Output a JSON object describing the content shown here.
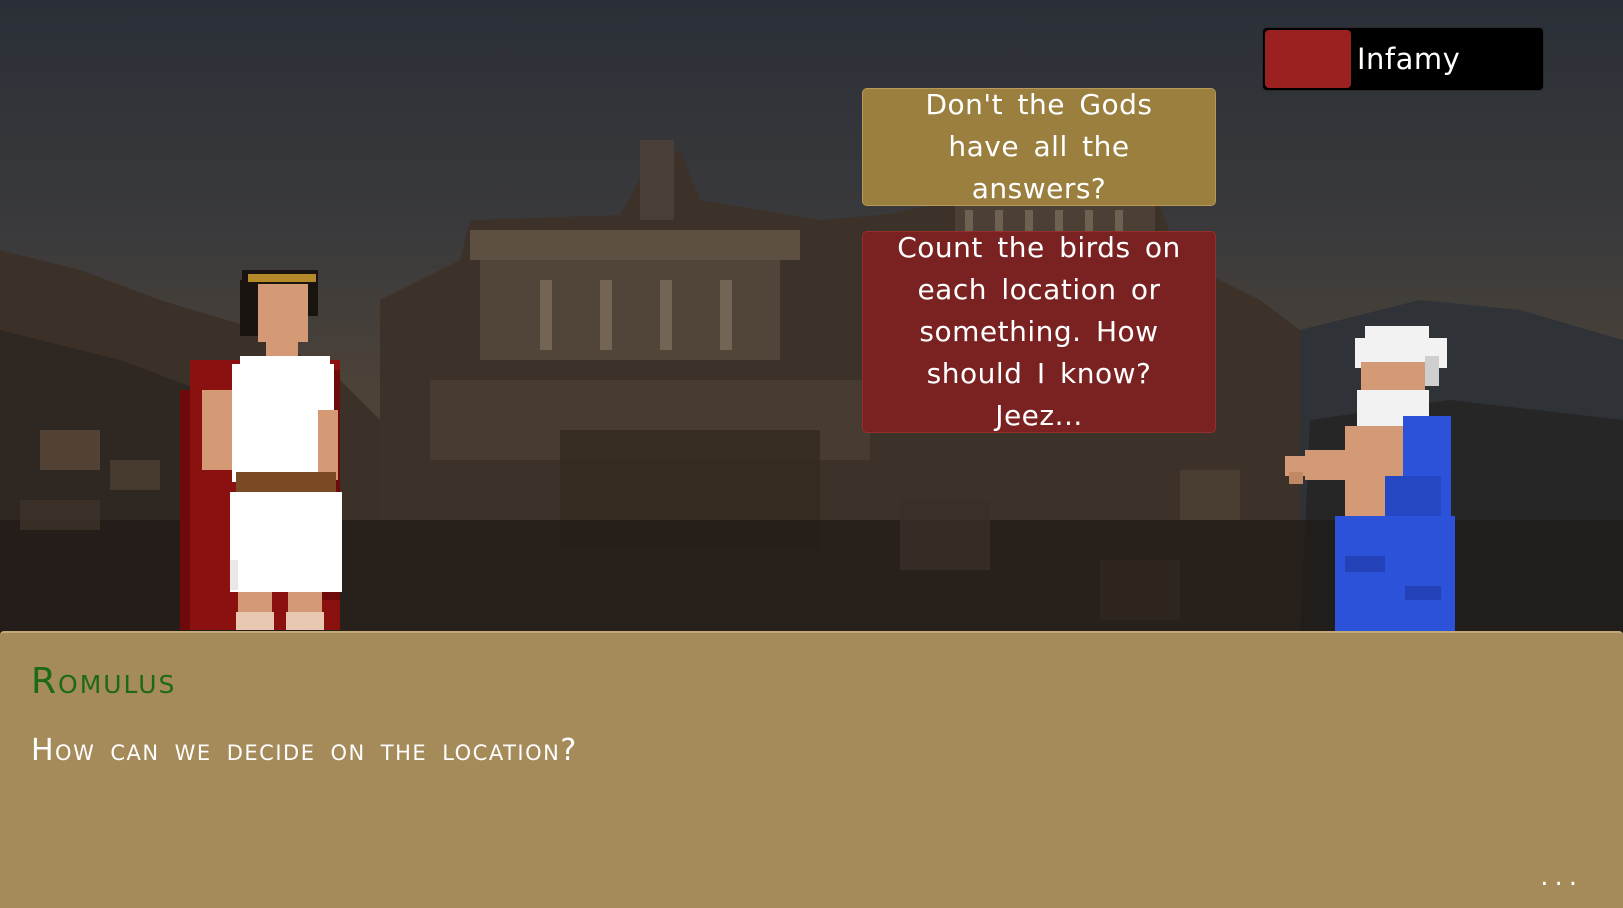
{
  "hud": {
    "infamy_label": "Infamy",
    "infamy_level": 0.31,
    "infamy_color": "#9b2121"
  },
  "choices": [
    {
      "text": "Don't the Gods have all the answers?",
      "color": "#9a7f3e"
    },
    {
      "text": "Count the birds on each location or something. How should I know? Jeez...",
      "color": "#7a2222"
    }
  ],
  "dialogue": {
    "speaker": "Romulus",
    "text": "How can we decide on the location?",
    "continue": "...",
    "name_color": "#1e6a14",
    "box_color": "#a58a5a"
  },
  "characters": {
    "left": "romulus-sprite",
    "right": "sage-sprite"
  }
}
